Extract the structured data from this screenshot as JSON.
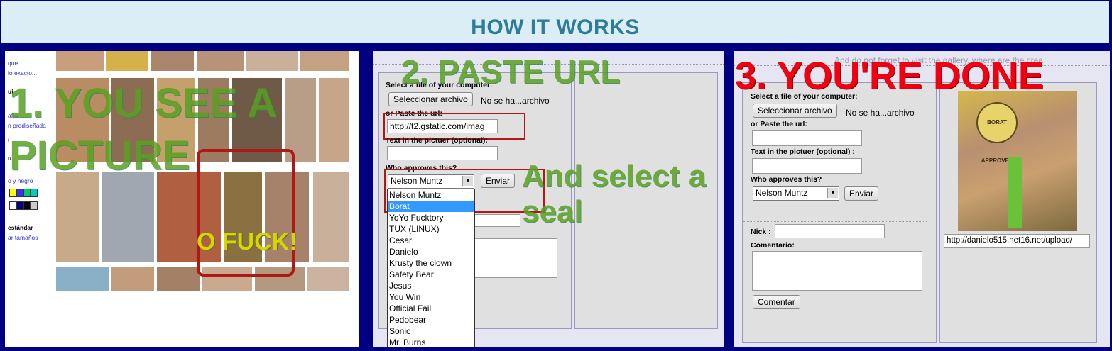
{
  "header": {
    "title": "HOW IT WORKS"
  },
  "step1": {
    "overlay_line1": "1. YOU SEE A",
    "overlay_line2": "PICTURE",
    "exclaim": "O FUCK!",
    "sidebar": [
      "que...",
      "lo exacto...",
      "ui",
      "afía",
      "n prediseñada",
      "i",
      "u",
      "o y negro",
      "estándar",
      "ar tamaños"
    ],
    "swatch_colors": [
      "#ffff00",
      "#3333ff",
      "#00cc66",
      "#00cccc",
      "#ffffff",
      "#000080",
      "#000000",
      "#cccccc"
    ]
  },
  "step2": {
    "overlay": "2. PASTE URL",
    "overlay_seal": "And select a seal",
    "file_label": "Select a file of your computer:",
    "file_button": "Seleccionar archivo",
    "file_status": "No se ha...archivo",
    "url_label": "or Paste the url:",
    "url_value": "http://t2.gstatic.com/imag",
    "text_label": "Text in the pictuer (optional):",
    "approve_label": "Who approves this?",
    "select_value": "Nelson Muntz",
    "send_button": "Enviar",
    "options": [
      "Nelson Muntz",
      "Borat",
      "YoYo Fucktory",
      "TUX (LINUX)",
      "Cesar",
      "Danielo",
      "Krusty the clown",
      "Safety Bear",
      "Jesus",
      "You Win",
      "Official Fail",
      "Pedobear",
      "Sonic",
      "Mr. Burns"
    ],
    "selected_option": "Borat"
  },
  "step3": {
    "overlay": "3. YOU'RE DONE",
    "faint_text": "And do not forget to visit the gallery, where are the crea",
    "file_label": "Select a file of your computer:",
    "file_button": "Seleccionar archivo",
    "file_status": "No se ha...archivo",
    "url_label": "or Paste the url:",
    "text_label": "Text in the pictuer (optional) :",
    "approve_label": "Who approves this?",
    "select_value": "Nelson Muntz",
    "send_button": "Enviar",
    "nick_label": "Nick :",
    "comment_label": "Comentario:",
    "comment_button": "Comentar",
    "result_url": "http://danielo515.net16.net/upload/",
    "seal_text": "BORAT APPROVES"
  }
}
